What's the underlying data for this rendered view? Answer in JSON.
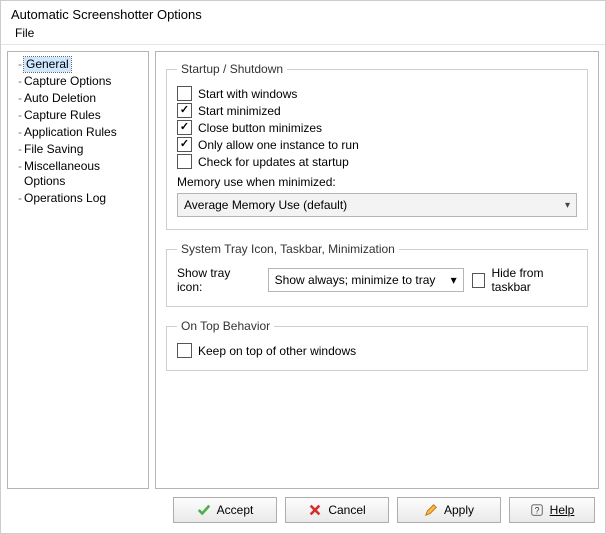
{
  "window": {
    "title": "Automatic Screenshotter Options"
  },
  "menu": {
    "file": "File"
  },
  "nav": {
    "items": [
      "General",
      "Capture Options",
      "Auto Deletion",
      "Capture Rules",
      "Application Rules",
      "File Saving",
      "Miscellaneous Options",
      "Operations Log"
    ],
    "selected_index": 0
  },
  "groups": {
    "startup": {
      "legend": "Startup / Shutdown",
      "opts": [
        {
          "label": "Start with windows",
          "checked": false
        },
        {
          "label": "Start minimized",
          "checked": true
        },
        {
          "label": "Close button minimizes",
          "checked": true
        },
        {
          "label": "Only allow one instance to run",
          "checked": true
        },
        {
          "label": "Check for updates at startup",
          "checked": false
        }
      ],
      "memory_label": "Memory use when minimized:",
      "memory_value": "Average Memory Use (default)"
    },
    "tray": {
      "legend": "System Tray Icon, Taskbar, Minimization",
      "show_label": "Show tray icon:",
      "show_value": "Show always; minimize to tray",
      "hide_label": "Hide from taskbar",
      "hide_checked": false
    },
    "ontop": {
      "legend": "On Top Behavior",
      "keep_label": "Keep on top of other windows",
      "keep_checked": false
    }
  },
  "buttons": {
    "accept": "Accept",
    "cancel": "Cancel",
    "apply": "Apply",
    "help": "Help"
  }
}
